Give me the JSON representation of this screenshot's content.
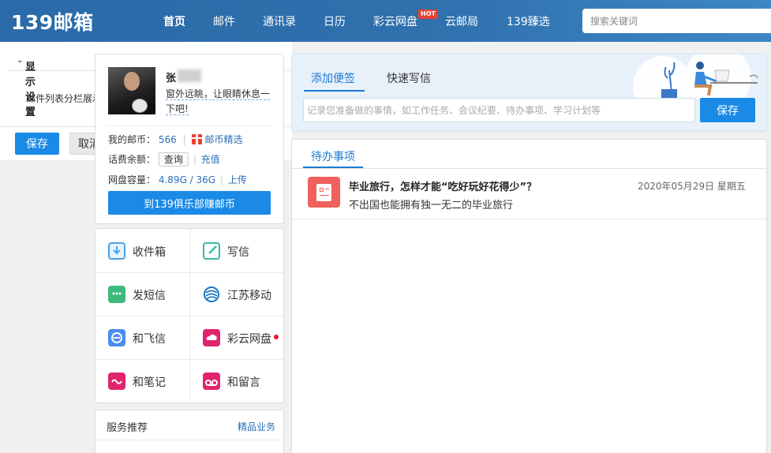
{
  "header": {
    "logo": "139邮箱",
    "nav": [
      {
        "label": "首页",
        "active": true
      },
      {
        "label": "邮件"
      },
      {
        "label": "通讯录"
      },
      {
        "label": "日历"
      },
      {
        "label": "彩云网盘",
        "badge": "HOT"
      },
      {
        "label": "云邮局"
      },
      {
        "label": "139臻选"
      }
    ],
    "search_placeholder": "搜索关键词"
  },
  "settings": {
    "title": "显示设置",
    "description": "邮件列表分栏展示",
    "save_label": "保存",
    "cancel_label": "取消"
  },
  "user": {
    "name": "张",
    "motto": "窗外远眺，让眼睛休息一下吧!",
    "coins_label": "我的邮币：",
    "coins_value": "566",
    "coins_link": "邮币精选",
    "balance_label": "话费余额：",
    "balance_query": "查询",
    "balance_recharge": "充值",
    "disk_label": "网盘容量：",
    "disk_value": "4.89G / 36G",
    "disk_upload": "上传",
    "club_button": "到139俱乐部赚邮币"
  },
  "apps": [
    {
      "label": "收件箱",
      "icon": "inbox-icon",
      "color": "#4aa3e8"
    },
    {
      "label": "写信",
      "icon": "compose-icon",
      "color": "#3bb8a8"
    },
    {
      "label": "发短信",
      "icon": "sms-icon",
      "color": "#3dba7c"
    },
    {
      "label": "江苏移动",
      "icon": "china-mobile-icon",
      "color": "#1a79c6"
    },
    {
      "label": "和飞信",
      "icon": "fetion-icon",
      "color": "#4a8cf0"
    },
    {
      "label": "彩云网盘",
      "icon": "cloud-disk-icon",
      "color": "#e0256e"
    },
    {
      "label": "和笔记",
      "icon": "note-icon",
      "color": "#e0256e"
    },
    {
      "label": "和留言",
      "icon": "voicemail-icon",
      "color": "#e0256e"
    }
  ],
  "services": {
    "title": "服务推荐",
    "link": "精品业务"
  },
  "memo": {
    "tab_add": "添加便签",
    "tab_quick": "快速写信",
    "placeholder": "记录您准备做的事情，如工作任务、会议纪要、待办事项、学习计划等",
    "save_label": "保存"
  },
  "todo": {
    "tab": "待办事项",
    "items": [
      {
        "title": "毕业旅行，怎样才能“吃好玩好花得少”？",
        "subtitle": "不出国也能拥有独一无二的毕业旅行",
        "date": "2020年05月29日 星期五"
      }
    ]
  }
}
